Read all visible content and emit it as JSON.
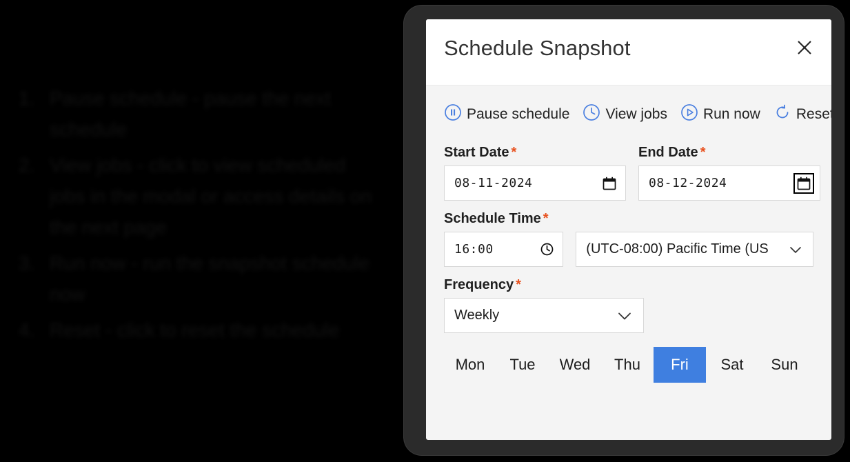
{
  "instructions": {
    "items": [
      "Pause schedule - pause the next schedule",
      "View jobs - click to view scheduled jobs in the modal or access details on the next page",
      "Run now - run the snapshot schedule now",
      "Reset - click to reset the schedule"
    ]
  },
  "dialog": {
    "title": "Schedule Snapshot",
    "close_icon": "close-icon",
    "actions": [
      {
        "label": "Pause schedule",
        "icon": "pause-circle-icon"
      },
      {
        "label": "View jobs",
        "icon": "clock-circle-icon"
      },
      {
        "label": "Run now",
        "icon": "play-circle-icon"
      },
      {
        "label": "Reset",
        "icon": "reset-arrow-icon"
      }
    ],
    "fields": {
      "start_date": {
        "label": "Start Date",
        "required_marker": "*",
        "value": "08-11-2024",
        "icon": "calendar-icon"
      },
      "end_date": {
        "label": "End Date",
        "required_marker": "*",
        "value": "08-12-2024",
        "icon": "calendar-icon"
      },
      "schedule_time": {
        "label": "Schedule Time",
        "required_marker": "*",
        "value": "16:00",
        "icon": "clock-icon"
      },
      "timezone": {
        "value": "(UTC-08:00) Pacific Time (US",
        "icon": "chevron-down-icon"
      },
      "frequency": {
        "label": "Frequency",
        "required_marker": "*",
        "value": "Weekly",
        "icon": "chevron-down-icon"
      }
    },
    "days": [
      {
        "label": "Mon",
        "selected": false
      },
      {
        "label": "Tue",
        "selected": false
      },
      {
        "label": "Wed",
        "selected": false
      },
      {
        "label": "Thu",
        "selected": false
      },
      {
        "label": "Fri",
        "selected": true
      },
      {
        "label": "Sat",
        "selected": false
      },
      {
        "label": "Sun",
        "selected": false
      }
    ]
  },
  "colors": {
    "accent_blue": "#3f7fe0",
    "icon_blue": "#4a7fe0",
    "required_orange": "#e8521f",
    "frame_dark": "#2b2b2b",
    "body_bg": "#f4f4f4"
  }
}
